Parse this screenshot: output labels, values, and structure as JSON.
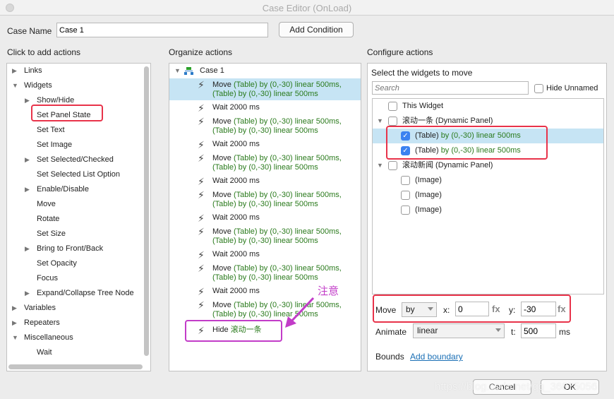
{
  "window": {
    "title": "Case Editor (OnLoad)"
  },
  "case": {
    "label": "Case Name",
    "value": "Case 1",
    "add_condition": "Add Condition"
  },
  "left": {
    "header": "Click to add actions",
    "items": [
      {
        "label": "Links",
        "level": 0,
        "tri": "right"
      },
      {
        "label": "Widgets",
        "level": 0,
        "tri": "down"
      },
      {
        "label": "Show/Hide",
        "level": 1,
        "tri": "right"
      },
      {
        "label": "Set Panel State",
        "level": 1,
        "tri": "",
        "highlight": true
      },
      {
        "label": "Set Text",
        "level": 1,
        "tri": ""
      },
      {
        "label": "Set Image",
        "level": 1,
        "tri": ""
      },
      {
        "label": "Set Selected/Checked",
        "level": 1,
        "tri": "right"
      },
      {
        "label": "Set Selected List Option",
        "level": 1,
        "tri": ""
      },
      {
        "label": "Enable/Disable",
        "level": 1,
        "tri": "right"
      },
      {
        "label": "Move",
        "level": 1,
        "tri": ""
      },
      {
        "label": "Rotate",
        "level": 1,
        "tri": ""
      },
      {
        "label": "Set Size",
        "level": 1,
        "tri": ""
      },
      {
        "label": "Bring to Front/Back",
        "level": 1,
        "tri": "right"
      },
      {
        "label": "Set Opacity",
        "level": 1,
        "tri": ""
      },
      {
        "label": "Focus",
        "level": 1,
        "tri": ""
      },
      {
        "label": "Expand/Collapse Tree Node",
        "level": 1,
        "tri": "right"
      },
      {
        "label": "Variables",
        "level": 0,
        "tri": "right"
      },
      {
        "label": "Repeaters",
        "level": 0,
        "tri": "right"
      },
      {
        "label": "Miscellaneous",
        "level": 0,
        "tri": "down"
      },
      {
        "label": "Wait",
        "level": 1,
        "tri": ""
      }
    ]
  },
  "middle": {
    "header": "Organize actions",
    "case_label": "Case 1",
    "move_prefix": "Move",
    "move_detail1": "(Table) by (0,-30) linear 500ms,",
    "move_detail2": "(Table) by (0,-30) linear 500ms",
    "wait_label": "Wait 2000 ms",
    "move_count": 7,
    "hide_prefix": "Hide",
    "hide_target": "滚动一条",
    "annotation": "注意"
  },
  "right": {
    "header": "Configure actions",
    "subheader": "Select the widgets to move",
    "search_placeholder": "Search",
    "hide_unnamed": "Hide Unnamed",
    "widgets": [
      {
        "label": "This Widget",
        "detail": "",
        "level": 0,
        "checked": false,
        "tri": false
      },
      {
        "label": "滚动一条 (Dynamic Panel)",
        "detail": "",
        "level": 0,
        "checked": false,
        "tri": true
      },
      {
        "label": "(Table)",
        "detail": "by (0,-30) linear 500ms",
        "level": 1,
        "checked": true,
        "tri": false,
        "selected": true
      },
      {
        "label": "(Table)",
        "detail": "by (0,-30) linear 500ms",
        "level": 1,
        "checked": true,
        "tri": false
      },
      {
        "label": "滚动新闻 (Dynamic Panel)",
        "detail": "",
        "level": 0,
        "checked": false,
        "tri": true
      },
      {
        "label": "(Image)",
        "detail": "",
        "level": 1,
        "checked": false,
        "tri": false
      },
      {
        "label": "(Image)",
        "detail": "",
        "level": 1,
        "checked": false,
        "tri": false
      },
      {
        "label": "(Image)",
        "detail": "",
        "level": 1,
        "checked": false,
        "tri": false
      }
    ],
    "move_label": "Move",
    "move_mode": "by",
    "x_label": "x:",
    "x_value": "0",
    "y_label": "y:",
    "y_value": "-30",
    "fx": "fx",
    "animate_label": "Animate",
    "animate_value": "linear",
    "t_label": "t:",
    "t_value": "500",
    "ms": "ms",
    "bounds_label": "Bounds",
    "add_boundary": "Add boundary"
  },
  "footer": {
    "cancel": "Cancel",
    "ok": "OK",
    "watermark": "https://blog.csdn.net/qq_36875056"
  },
  "colors": {
    "highlight_red": "#e8334a",
    "annotation_magenta": "#c23cc8",
    "selected_row": "#c6e4f4",
    "action_green": "#2a7a1c",
    "link_blue": "#1a6fb5"
  }
}
